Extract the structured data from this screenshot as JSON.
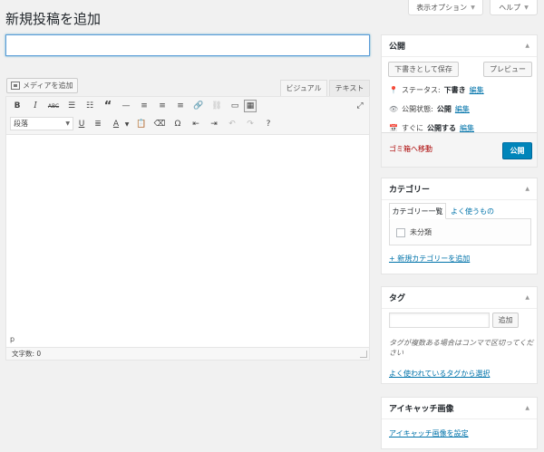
{
  "header": {
    "screen_options": "表示オプション",
    "help": "ヘルプ",
    "page_title": "新規投稿を追加"
  },
  "editor": {
    "title_value": "",
    "add_media": "メディアを追加",
    "tab_visual": "ビジュアル",
    "tab_text": "テキスト",
    "format_select": "段落",
    "path": "p",
    "word_count": "文字数: 0"
  },
  "publish": {
    "title": "公開",
    "save_draft": "下書きとして保存",
    "preview": "プレビュー",
    "status_label": "ステータス:",
    "status_value": "下書き",
    "visibility_label": "公開状態:",
    "visibility_value": "公開",
    "schedule_label": "すぐに",
    "schedule_value": "公開する",
    "edit": "編集",
    "trash": "ゴミ箱へ移動",
    "publish_btn": "公開"
  },
  "categories": {
    "title": "カテゴリー",
    "tab_all": "カテゴリー一覧",
    "tab_popular": "よく使うもの",
    "items": [
      "未分類"
    ],
    "add_new": "+ 新規カテゴリーを追加"
  },
  "tags": {
    "title": "タグ",
    "add_button": "追加",
    "hint_line1": "タグが複数ある場合はコンマで区切ってくだ",
    "hint_line2": "さい",
    "choose_used": "よく使われているタグから選択"
  },
  "featured_image": {
    "title": "アイキャッチ画像",
    "set_link": "アイキャッチ画像を設定"
  },
  "colors": {
    "accent": "#0073aa",
    "primary_button": "#0085ba",
    "trash": "#a00"
  }
}
